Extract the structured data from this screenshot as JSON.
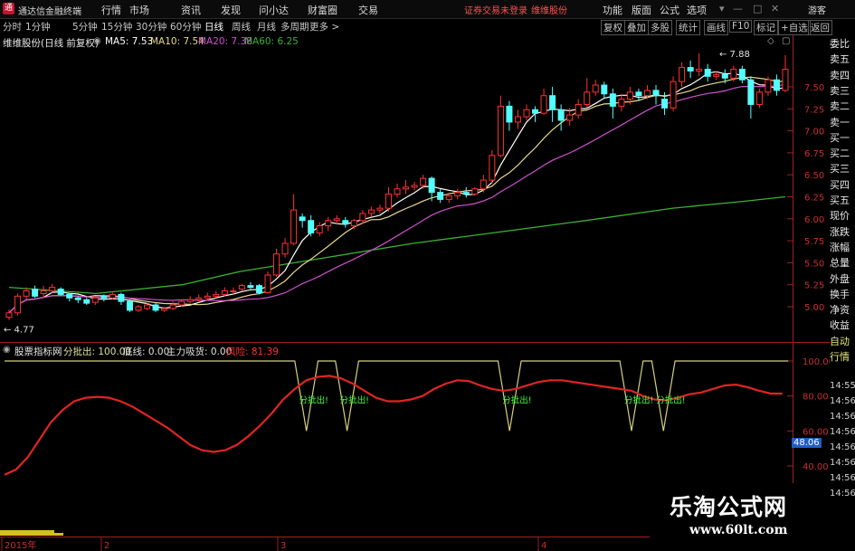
{
  "app": {
    "title": "通达信金融终端",
    "menu": [
      "行情",
      "市场",
      "资讯",
      "发现",
      "问小达",
      "财富圈",
      "交易"
    ],
    "notice_login": "证券交易未登录",
    "notice_stock": "维维股份",
    "menu_right": [
      "功能",
      "版面",
      "公式",
      "选项"
    ],
    "user": "游客"
  },
  "toolbar": {
    "periods": [
      "分时",
      "1分钟",
      "5分钟",
      "15分钟",
      "30分钟",
      "60分钟",
      "日线",
      "周线",
      "月线",
      "多周期",
      "更多 >"
    ],
    "active_period": "日线",
    "right_buttons": [
      "复权",
      "叠加",
      "多股",
      "统计",
      "画线",
      "F10",
      "标记",
      "+自选",
      "返回"
    ]
  },
  "main_chart": {
    "stock_label": "维维股份(日线 前复权)",
    "ma": [
      {
        "label": "MA5: 7.53",
        "color": "#ffffff"
      },
      {
        "label": "MA10: 7.54",
        "color": "#e8d88a"
      },
      {
        "label": "MA20: 7.38",
        "color": "#d050d0"
      },
      {
        "label": "MA60: 6.25",
        "color": "#3cb034"
      }
    ],
    "price_ticks": [
      "7.50",
      "7.25",
      "7.00",
      "6.75",
      "6.50",
      "6.25",
      "6.00",
      "5.75",
      "5.50",
      "5.25",
      "5.00"
    ],
    "high_marker": "7.88",
    "low_marker": "4.77"
  },
  "indicator": {
    "name": "股票指标网",
    "items": [
      {
        "label": "分批出: 100.00",
        "color": "#e0e0a0"
      },
      {
        "label": "底线: 0.00",
        "color": "#e0e0e0"
      },
      {
        "label": "主力吸货: 0.00",
        "color": "#e0e0e0"
      },
      {
        "label": "风险: 81.39",
        "color": "#ff3030"
      }
    ],
    "ticks": [
      "100.00",
      "80.00",
      "60.00",
      "40.00"
    ],
    "signal_label": "分批出!",
    "value_badge": "48.06"
  },
  "date_axis": [
    "2015年",
    "2",
    "3",
    "4"
  ],
  "sidebar": {
    "items": [
      "委比",
      "卖五",
      "卖四",
      "卖三",
      "卖二",
      "卖一",
      "买一",
      "买二",
      "买三",
      "买四",
      "买五",
      "现价",
      "涨跌",
      "涨幅",
      "总量",
      "外盘",
      "换手",
      "净资",
      "收益",
      "自动",
      "行情"
    ],
    "times": [
      "14:55",
      "14:56",
      "14:56",
      "14:56",
      "14:56",
      "14:56",
      "14:56",
      "14:56"
    ]
  },
  "watermark": {
    "name": "乐淘公式网",
    "url": "www.60lt.com"
  },
  "chart_data": {
    "type": "candlestick",
    "price_range": [
      4.77,
      7.88
    ],
    "ma5_last": 7.53,
    "ma10_last": 7.54,
    "ma20_last": 7.38,
    "ma60_last": 6.25,
    "candles": [
      [
        4.88,
        4.93,
        4.85,
        4.97
      ],
      [
        4.93,
        5.12,
        4.9,
        5.15
      ],
      [
        5.12,
        5.18,
        5.08,
        5.22
      ],
      [
        5.2,
        5.12,
        5.1,
        5.24
      ],
      [
        5.15,
        5.18,
        5.1,
        5.24
      ],
      [
        5.18,
        5.22,
        5.15,
        5.26
      ],
      [
        5.2,
        5.14,
        5.12,
        5.22
      ],
      [
        5.14,
        5.1,
        5.06,
        5.16
      ],
      [
        5.1,
        5.08,
        5.04,
        5.12
      ],
      [
        5.08,
        5.04,
        5.02,
        5.1
      ],
      [
        5.05,
        5.1,
        5.02,
        5.12
      ],
      [
        5.12,
        5.1,
        5.06,
        5.14
      ],
      [
        5.1,
        5.14,
        5.08,
        5.16
      ],
      [
        5.14,
        5.06,
        5.02,
        5.16
      ],
      [
        5.06,
        4.96,
        4.94,
        5.08
      ],
      [
        4.96,
        5.0,
        4.94,
        5.02
      ],
      [
        4.98,
        5.02,
        4.96,
        5.04
      ],
      [
        5.02,
        4.96,
        4.94,
        5.04
      ],
      [
        4.96,
        4.98,
        4.94,
        5.0
      ],
      [
        4.98,
        5.02,
        4.96,
        5.06
      ],
      [
        5.02,
        5.06,
        5.0,
        5.08
      ],
      [
        5.06,
        5.08,
        5.04,
        5.12
      ],
      [
        5.08,
        5.1,
        5.06,
        5.14
      ],
      [
        5.1,
        5.12,
        5.08,
        5.16
      ],
      [
        5.12,
        5.14,
        5.1,
        5.18
      ],
      [
        5.14,
        5.18,
        5.12,
        5.22
      ],
      [
        5.18,
        5.18,
        5.14,
        5.22
      ],
      [
        5.2,
        5.24,
        5.18,
        5.26
      ],
      [
        5.24,
        5.22,
        5.2,
        5.28
      ],
      [
        5.24,
        5.16,
        5.14,
        5.26
      ],
      [
        5.16,
        5.36,
        5.15,
        5.4
      ],
      [
        5.36,
        5.6,
        5.34,
        5.66
      ],
      [
        5.6,
        5.72,
        5.56,
        5.78
      ],
      [
        5.72,
        6.1,
        5.7,
        6.28
      ],
      [
        6.02,
        5.98,
        5.9,
        6.06
      ],
      [
        5.98,
        5.84,
        5.8,
        6.04
      ],
      [
        5.84,
        5.92,
        5.8,
        5.96
      ],
      [
        5.92,
        5.98,
        5.86,
        6.02
      ],
      [
        5.98,
        6.0,
        5.94,
        6.04
      ],
      [
        5.98,
        5.94,
        5.9,
        6.02
      ],
      [
        5.92,
        5.98,
        5.88,
        6.0
      ],
      [
        5.98,
        6.06,
        5.94,
        6.1
      ],
      [
        6.06,
        6.1,
        6.02,
        6.14
      ],
      [
        6.1,
        6.12,
        6.06,
        6.16
      ],
      [
        6.12,
        6.28,
        6.08,
        6.36
      ],
      [
        6.28,
        6.34,
        6.24,
        6.4
      ],
      [
        6.34,
        6.36,
        6.28,
        6.44
      ],
      [
        6.36,
        6.38,
        6.32,
        6.42
      ],
      [
        6.38,
        6.46,
        6.34,
        6.5
      ],
      [
        6.46,
        6.3,
        6.2,
        6.48
      ],
      [
        6.3,
        6.22,
        6.18,
        6.34
      ],
      [
        6.22,
        6.26,
        6.18,
        6.3
      ],
      [
        6.26,
        6.3,
        6.22,
        6.34
      ],
      [
        6.3,
        6.28,
        6.24,
        6.36
      ],
      [
        6.28,
        6.34,
        6.26,
        6.36
      ],
      [
        6.34,
        6.44,
        6.3,
        6.5
      ],
      [
        6.44,
        6.72,
        6.4,
        6.78
      ],
      [
        6.72,
        7.28,
        6.7,
        7.4
      ],
      [
        7.28,
        7.1,
        7.0,
        7.34
      ],
      [
        7.1,
        7.16,
        7.02,
        7.24
      ],
      [
        7.16,
        7.24,
        7.12,
        7.3
      ],
      [
        7.24,
        7.2,
        7.1,
        7.28
      ],
      [
        7.2,
        7.4,
        7.18,
        7.48
      ],
      [
        7.4,
        7.24,
        7.1,
        7.5
      ],
      [
        7.24,
        7.12,
        7.0,
        7.3
      ],
      [
        7.12,
        7.18,
        7.06,
        7.26
      ],
      [
        7.18,
        7.3,
        7.14,
        7.36
      ],
      [
        7.3,
        7.44,
        7.26,
        7.6
      ],
      [
        7.44,
        7.52,
        7.4,
        7.58
      ],
      [
        7.52,
        7.42,
        7.36,
        7.56
      ],
      [
        7.42,
        7.28,
        7.14,
        7.48
      ],
      [
        7.28,
        7.36,
        7.22,
        7.42
      ],
      [
        7.36,
        7.44,
        7.3,
        7.5
      ],
      [
        7.44,
        7.4,
        7.34,
        7.48
      ],
      [
        7.4,
        7.46,
        7.36,
        7.52
      ],
      [
        7.46,
        7.4,
        7.3,
        7.52
      ],
      [
        7.36,
        7.26,
        7.18,
        7.44
      ],
      [
        7.26,
        7.56,
        7.22,
        7.62
      ],
      [
        7.56,
        7.72,
        7.5,
        7.78
      ],
      [
        7.72,
        7.68,
        7.6,
        7.8
      ],
      [
        7.68,
        7.7,
        7.62,
        7.88
      ],
      [
        7.7,
        7.62,
        7.56,
        7.76
      ],
      [
        7.62,
        7.64,
        7.58,
        7.68
      ],
      [
        7.64,
        7.6,
        7.54,
        7.7
      ],
      [
        7.6,
        7.7,
        7.56,
        7.74
      ],
      [
        7.7,
        7.58,
        7.54,
        7.74
      ],
      [
        7.58,
        7.3,
        7.14,
        7.62
      ],
      [
        7.3,
        7.44,
        7.26,
        7.48
      ],
      [
        7.44,
        7.58,
        7.4,
        7.62
      ],
      [
        7.58,
        7.46,
        7.4,
        7.64
      ],
      [
        7.46,
        7.7,
        7.44,
        7.86
      ]
    ],
    "ma60": [
      [
        0,
        5.22
      ],
      [
        30,
        5.15
      ],
      [
        60,
        5.25
      ],
      [
        80,
        5.4
      ],
      [
        110,
        5.56
      ],
      [
        140,
        5.72
      ],
      [
        170,
        5.85
      ],
      [
        200,
        5.98
      ],
      [
        230,
        6.12
      ],
      [
        255,
        6.2
      ],
      [
        269,
        6.25
      ]
    ],
    "indicator_risk": [
      [
        0,
        35
      ],
      [
        4,
        38
      ],
      [
        8,
        45
      ],
      [
        12,
        55
      ],
      [
        16,
        65
      ],
      [
        20,
        72
      ],
      [
        24,
        77
      ],
      [
        28,
        79
      ],
      [
        32,
        79.5
      ],
      [
        36,
        79
      ],
      [
        40,
        77
      ],
      [
        44,
        74
      ],
      [
        48,
        70
      ],
      [
        52,
        66
      ],
      [
        56,
        62
      ],
      [
        60,
        57
      ],
      [
        64,
        52
      ],
      [
        68,
        49
      ],
      [
        72,
        48
      ],
      [
        76,
        49
      ],
      [
        80,
        52
      ],
      [
        84,
        57
      ],
      [
        88,
        63
      ],
      [
        92,
        70
      ],
      [
        96,
        78
      ],
      [
        100,
        84
      ],
      [
        104,
        89
      ],
      [
        108,
        91
      ],
      [
        112,
        91.5
      ],
      [
        116,
        90
      ],
      [
        120,
        87
      ],
      [
        124,
        83
      ],
      [
        128,
        79
      ],
      [
        132,
        77
      ],
      [
        136,
        77
      ],
      [
        140,
        78
      ],
      [
        144,
        80
      ],
      [
        148,
        84
      ],
      [
        152,
        87
      ],
      [
        156,
        89
      ],
      [
        160,
        88.5
      ],
      [
        164,
        86
      ],
      [
        168,
        84
      ],
      [
        172,
        83
      ],
      [
        176,
        84
      ],
      [
        180,
        86
      ],
      [
        184,
        88
      ],
      [
        188,
        89
      ],
      [
        192,
        89
      ],
      [
        196,
        88
      ],
      [
        200,
        87
      ],
      [
        204,
        86
      ],
      [
        208,
        85
      ],
      [
        212,
        84
      ],
      [
        216,
        83
      ],
      [
        220,
        80
      ],
      [
        224,
        78
      ],
      [
        228,
        77.5
      ],
      [
        232,
        79
      ],
      [
        236,
        81
      ],
      [
        240,
        82
      ],
      [
        244,
        84
      ],
      [
        248,
        86
      ],
      [
        252,
        86.5
      ],
      [
        256,
        85
      ],
      [
        260,
        83
      ],
      [
        264,
        81.4
      ],
      [
        268,
        81.39
      ]
    ],
    "indicator_fenpi": [
      [
        0,
        100
      ],
      [
        100,
        100
      ],
      [
        104,
        60
      ],
      [
        108,
        100
      ],
      [
        114,
        100
      ],
      [
        118,
        60
      ],
      [
        122,
        100
      ],
      [
        170,
        100
      ],
      [
        174,
        60
      ],
      [
        178,
        100
      ],
      [
        212,
        100
      ],
      [
        216,
        60
      ],
      [
        220,
        100
      ],
      [
        223,
        100
      ],
      [
        227,
        60
      ],
      [
        231,
        100
      ],
      [
        270,
        100
      ]
    ],
    "indicator_range": [
      30,
      100
    ]
  }
}
